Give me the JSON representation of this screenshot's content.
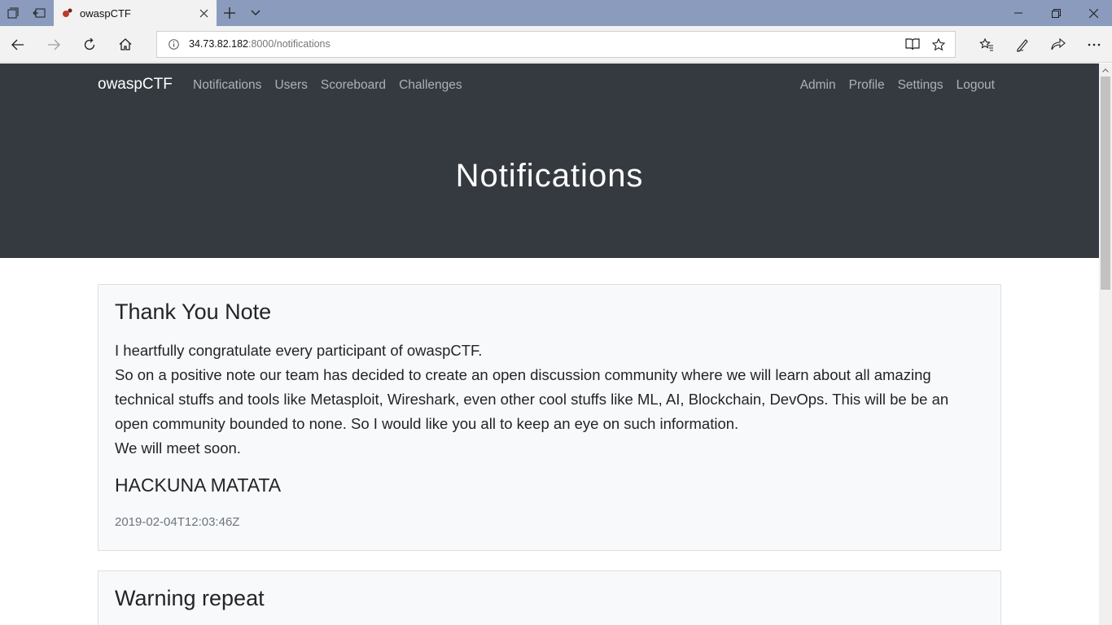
{
  "browser": {
    "tab_title": "owaspCTF",
    "url_host": "34.73.82.182",
    "url_path": ":8000/notifications"
  },
  "navbar": {
    "brand": "owaspCTF",
    "left_links": [
      "Notifications",
      "Users",
      "Scoreboard",
      "Challenges"
    ],
    "right_links": [
      "Admin",
      "Profile",
      "Settings",
      "Logout"
    ]
  },
  "page": {
    "title": "Notifications"
  },
  "notifications": [
    {
      "title": "Thank You Note",
      "body_lines": [
        "I heartfully congratulate every participant of owaspCTF.",
        "So on a positive note our team has decided to create an open discussion community where we will learn about all amazing technical stuffs and tools like Metasploit, Wireshark, even other cool stuffs like ML, AI, Blockchain, DevOps. This will be be an open community bounded to none. So I would like you all to keep an eye on such information.",
        "We will meet soon."
      ],
      "sign": "HACKUNA MATATA",
      "timestamp": "2019-02-04T12:03:46Z"
    },
    {
      "title": "Warning repeat"
    }
  ],
  "colors": {
    "tabbar": "#8a9bbd",
    "navbar_bg": "#343a40",
    "card_bg": "#f8f9fa",
    "text": "#212529",
    "muted": "#6c757d"
  }
}
